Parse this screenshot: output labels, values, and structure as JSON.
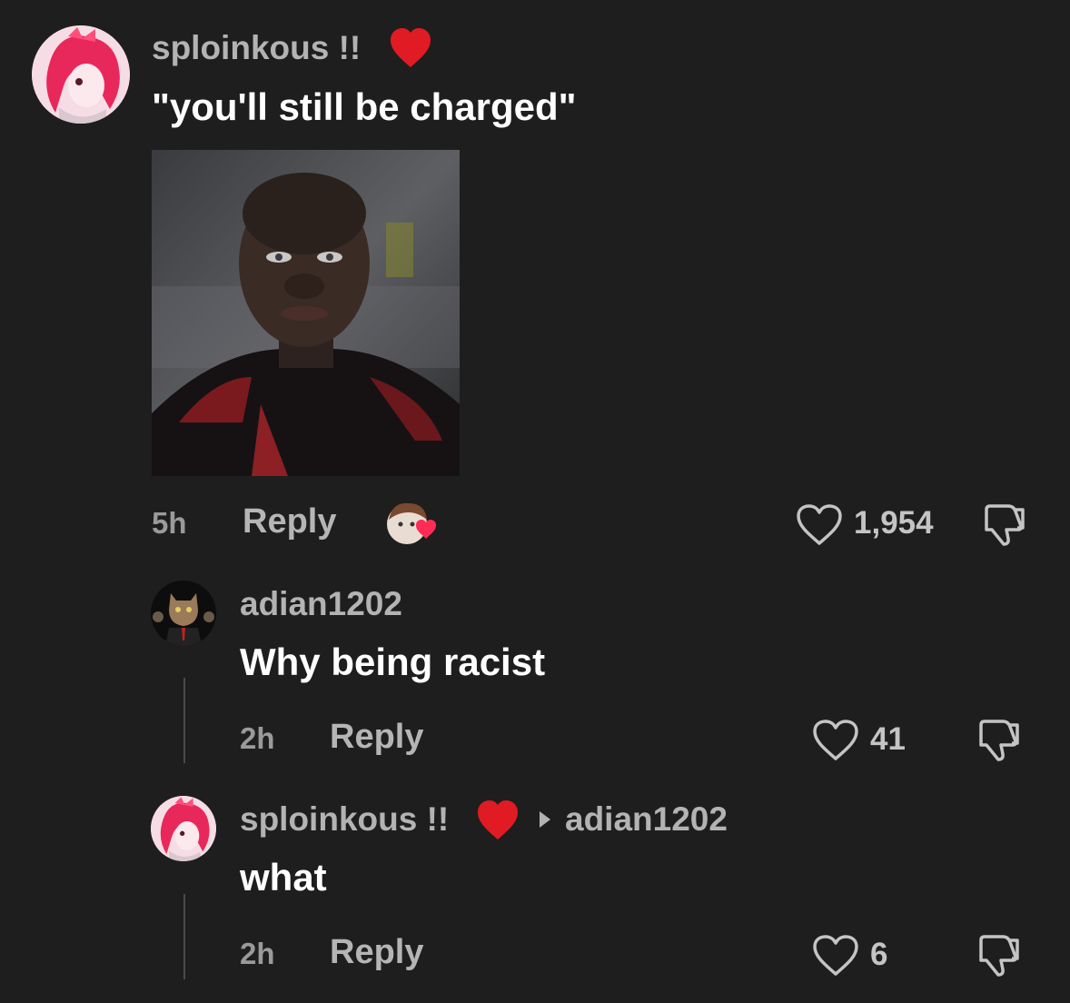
{
  "comments": [
    {
      "username": "sploinkous !!",
      "username_emoji": "red-heart",
      "text": "\"you'll still be charged\"",
      "has_image": true,
      "time": "5h",
      "reply_label": "Reply",
      "creator_liked": true,
      "likes": "1,954"
    },
    {
      "username": "adian1202",
      "text": "Why being racist",
      "time": "2h",
      "reply_label": "Reply",
      "likes": "41"
    },
    {
      "username": "sploinkous !!",
      "username_emoji": "red-heart",
      "reply_to": "adian1202",
      "text": "what",
      "time": "2h",
      "reply_label": "Reply",
      "likes": "6"
    }
  ],
  "colors": {
    "background": "#1e1e1e",
    "username": "#b3b3b3",
    "text": "#ffffff",
    "heart": "#e01b24"
  }
}
